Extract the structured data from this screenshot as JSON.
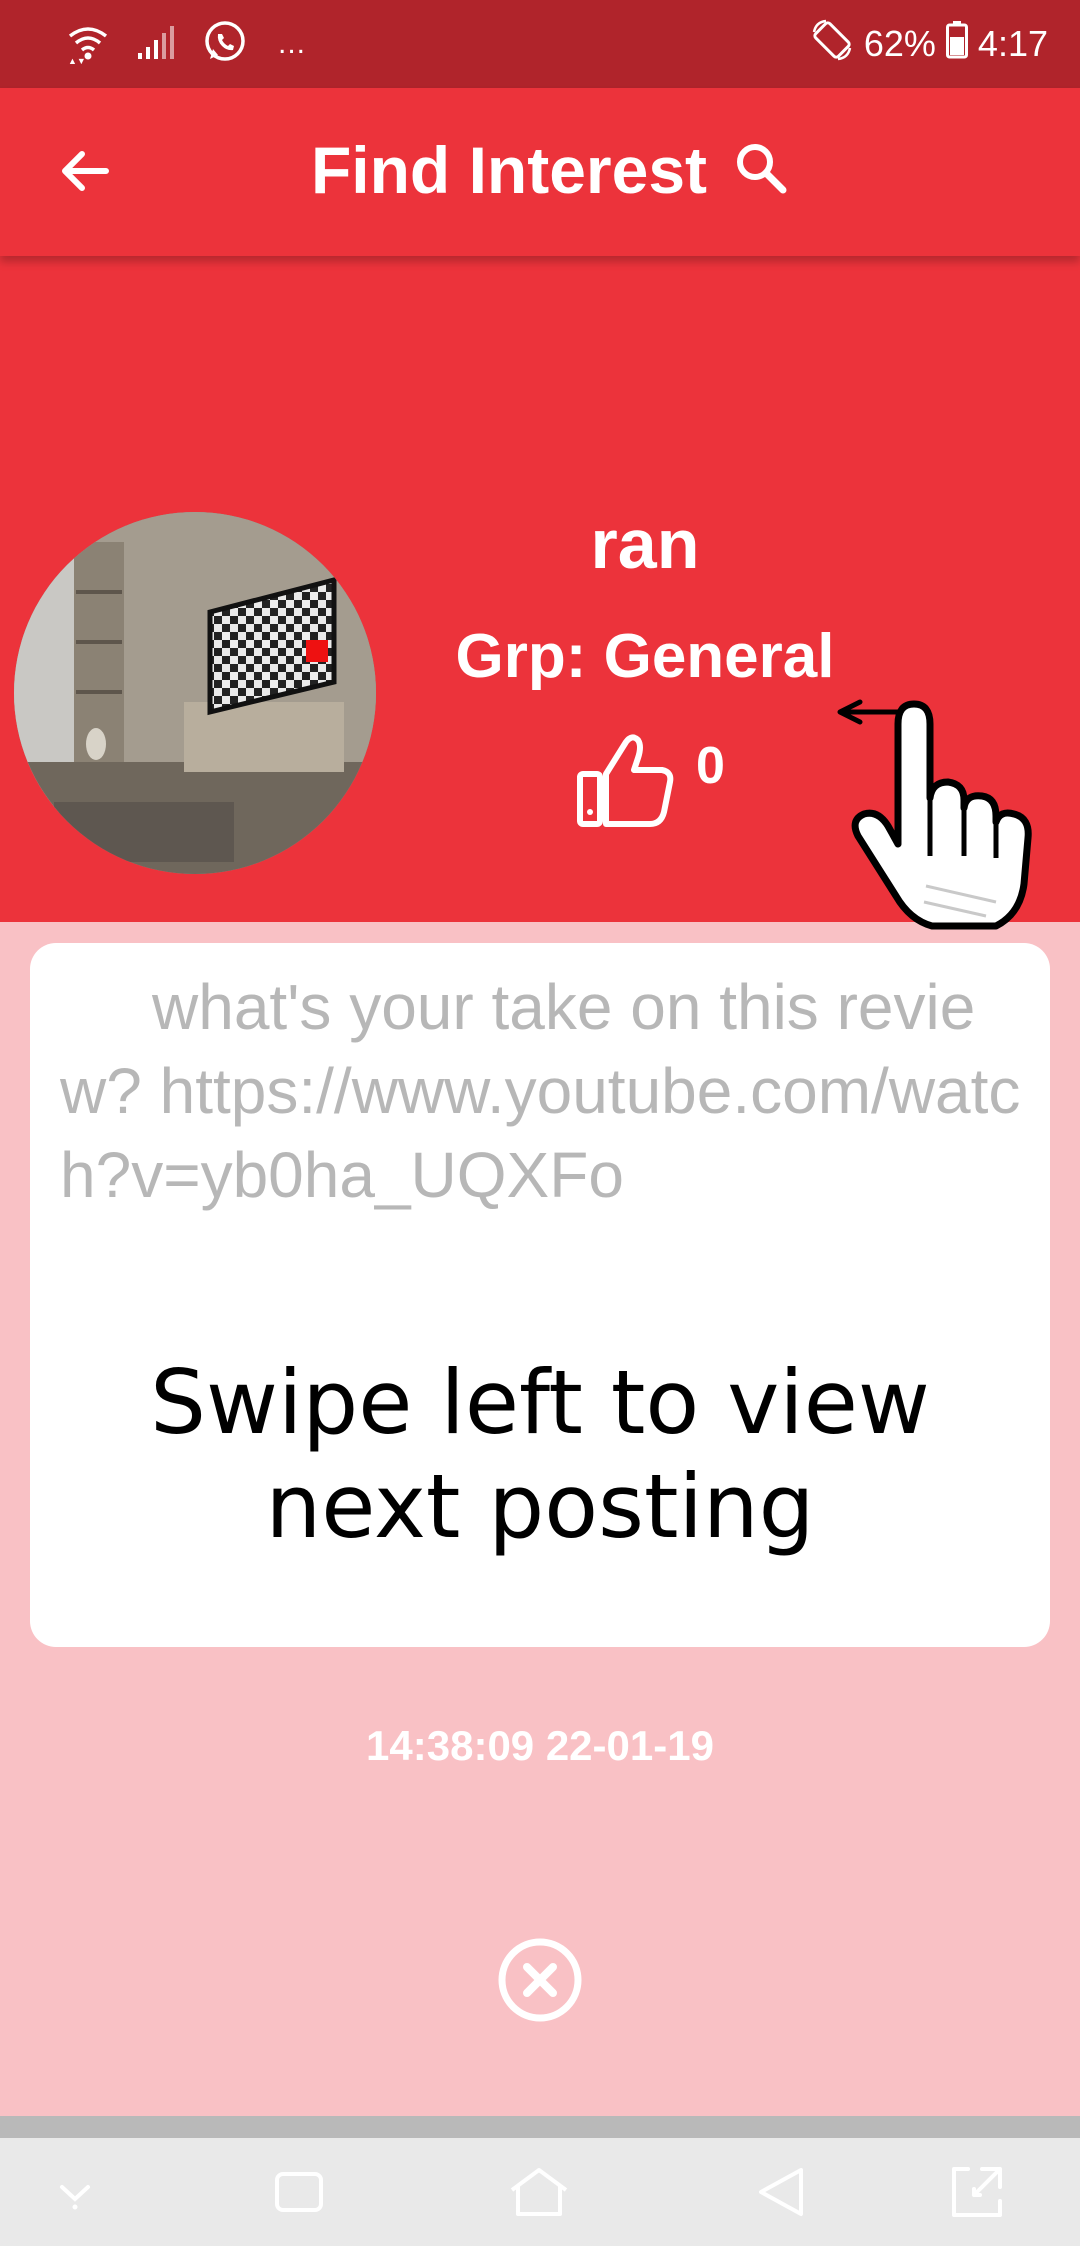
{
  "status_bar": {
    "dots": "...",
    "battery": "62%",
    "time": "4:17",
    "icons": [
      "wifi-icon",
      "signal-icon",
      "whatsapp-icon",
      "rotate-icon",
      "battery-icon"
    ]
  },
  "app_bar": {
    "title": "Find Interest",
    "icons": [
      "back-arrow-icon",
      "search-icon"
    ]
  },
  "profile": {
    "name": "ran",
    "group": "Grp: General",
    "likes": "0",
    "icons": [
      "thumbs-up-icon",
      "swipe-hand-icon"
    ]
  },
  "post": {
    "text": "what's your take on this review? https://www.youtube.com/watch?v=yb0ha_UQXFo",
    "swipe_hint_line1": "Swipe left to view",
    "swipe_hint_line2": "next posting",
    "timestamp": "14:38:09 22-01-19"
  },
  "actions": {
    "dismiss_icon": "close-circle-icon"
  },
  "nav_bar": {
    "icons": [
      "hide-keyboard-icon",
      "recents-icon",
      "home-icon",
      "back-icon",
      "fullscreen-icon"
    ]
  },
  "colors": {
    "status_bar": "#b0242b",
    "primary": "#ec333b",
    "background": "#f9c1c5",
    "card": "#ffffff",
    "post_text": "#b7b7b7"
  }
}
